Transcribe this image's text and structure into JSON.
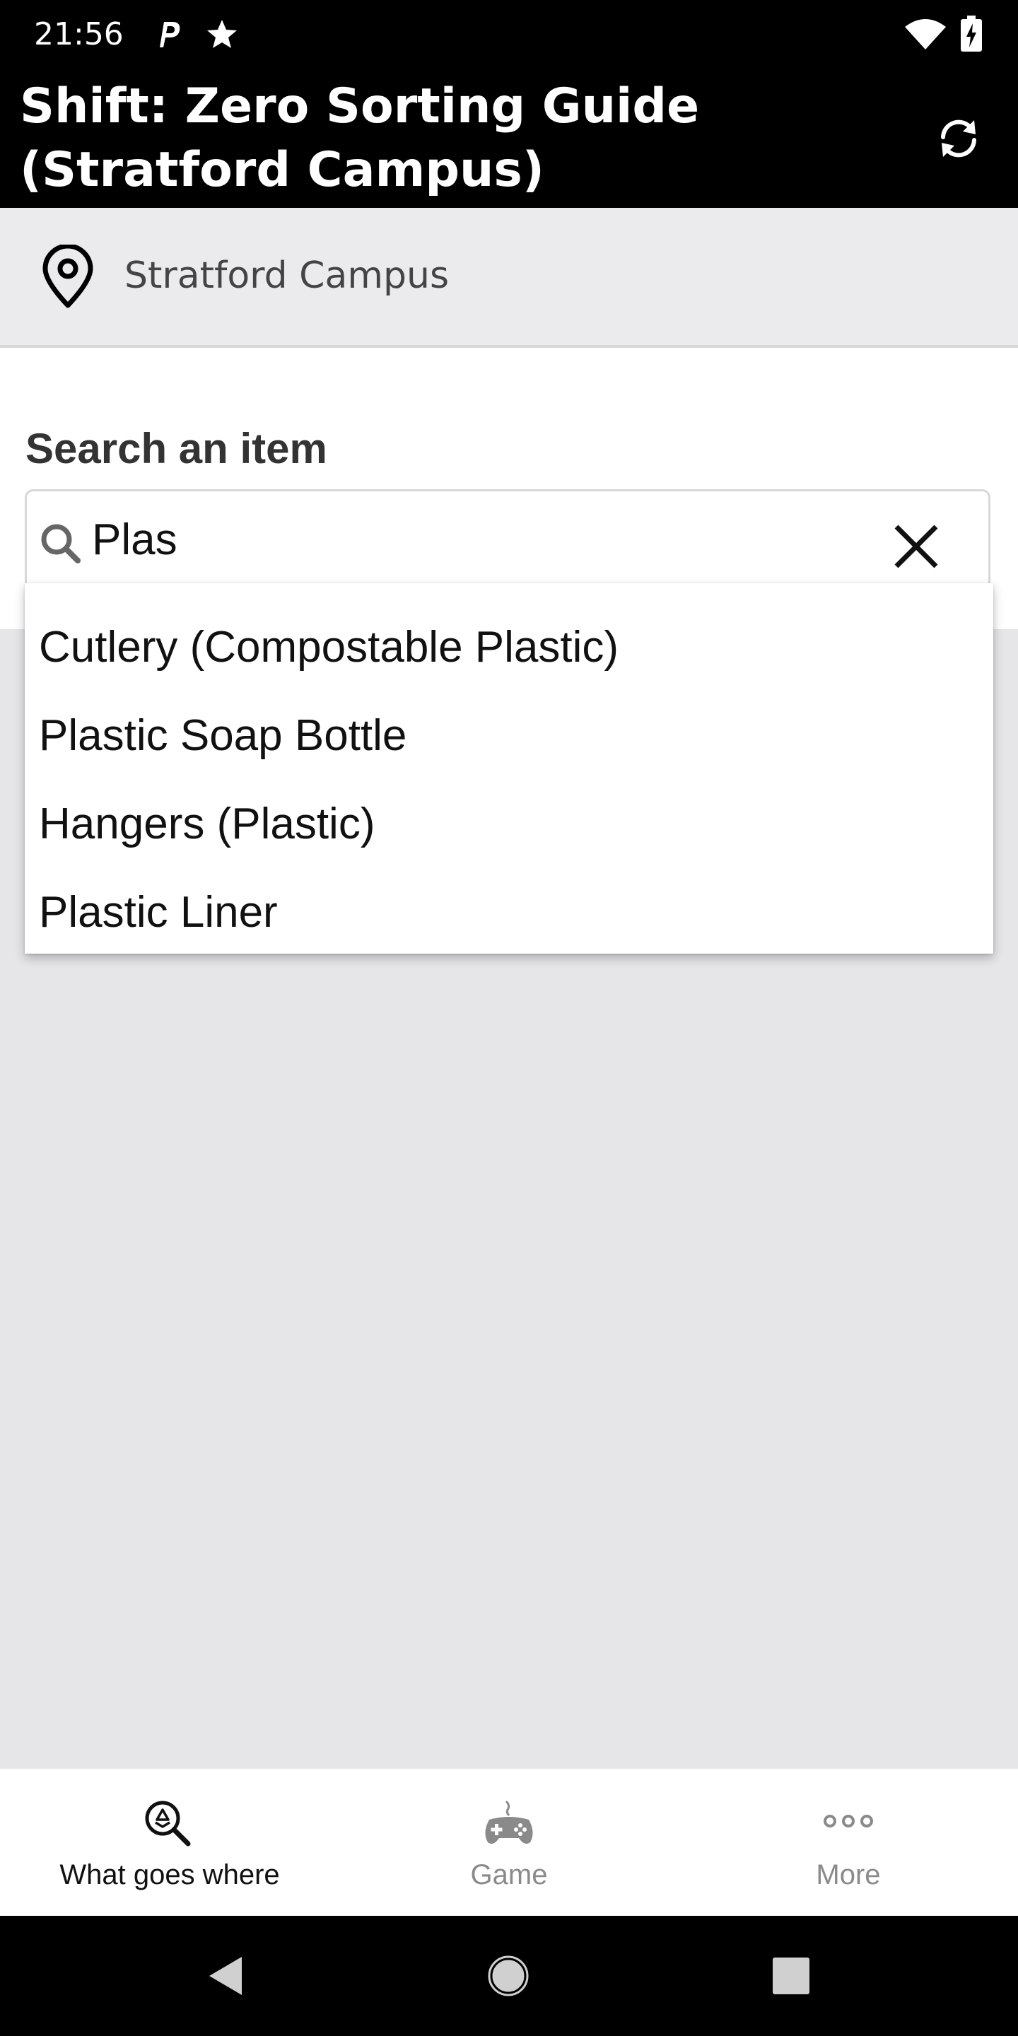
{
  "status_bar": {
    "time": "21:56"
  },
  "app_bar": {
    "title": "Shift: Zero Sorting Guide (Stratford Campus)"
  },
  "location": {
    "name": "Stratford Campus"
  },
  "search": {
    "label": "Search an item",
    "value": "Plas"
  },
  "suggestions": [
    "Cutlery (Compostable Plastic)",
    "Plastic Soap Bottle",
    "Hangers (Plastic)",
    "Plastic Liner"
  ],
  "bottom_nav": {
    "items": [
      {
        "label": "What goes where",
        "icon": "recycle-search-icon",
        "active": true
      },
      {
        "label": "Game",
        "icon": "gamepad-icon",
        "active": false
      },
      {
        "label": "More",
        "icon": "more-dots-icon",
        "active": false
      }
    ]
  },
  "colors": {
    "bar_background": "#000000",
    "content_background": "#e6e6e8",
    "active_nav": "#111111",
    "inactive_nav": "#8a8a8a"
  }
}
